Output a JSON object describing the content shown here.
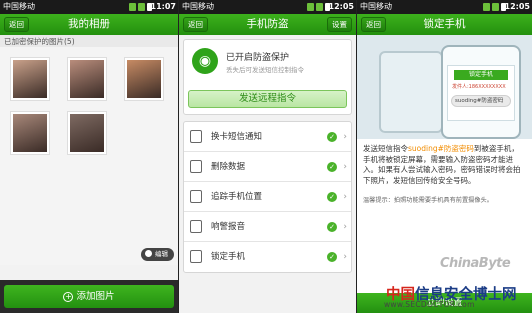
{
  "colors": {
    "accent": "#2a9a14",
    "accent_light": "#b9e6a3",
    "highlight": "#f28c00",
    "status_bar": "#1a1a1a"
  },
  "panel1": {
    "status": {
      "carrier": "中国移动",
      "time": "11:07"
    },
    "header": {
      "back": "返回",
      "title": "我的相册"
    },
    "section_label": "已加密保护的图片(5)",
    "photos": [
      {
        "name": "photo-1",
        "color": "#c9a18a"
      },
      {
        "name": "photo-2",
        "color": "#b98d7c"
      },
      {
        "name": "photo-3",
        "color": "#c78b64"
      },
      {
        "name": "photo-4",
        "color": "#a8887a"
      },
      {
        "name": "photo-5",
        "color": "#7e6a62"
      }
    ],
    "edit_button": "编辑",
    "add_button": "添加图片"
  },
  "panel2": {
    "status": {
      "carrier": "中国移动",
      "time": "12:05"
    },
    "header": {
      "back": "返回",
      "title": "手机防盗",
      "settings": "设置"
    },
    "protect_title": "已开启防盗保护",
    "protect_sub": "丢失后可发送短信控制指令",
    "remote_button": "发送远程指令",
    "menu": [
      {
        "label": "换卡短信通知",
        "icon": "envelope-icon"
      },
      {
        "label": "删除数据",
        "icon": "trash-icon"
      },
      {
        "label": "追踪手机位置",
        "icon": "location-icon"
      },
      {
        "label": "响警报音",
        "icon": "speaker-icon"
      },
      {
        "label": "锁定手机",
        "icon": "lock-icon"
      }
    ]
  },
  "panel3": {
    "status": {
      "carrier": "中国移动",
      "time": "12:05"
    },
    "header": {
      "back": "返回",
      "title": "锁定手机"
    },
    "illus": {
      "lock_title": "锁定手机",
      "sender": "发件人:186XXXXXXXX",
      "bubble": "suoding#防盗密码"
    },
    "desc_before": "发送短信指令",
    "desc_highlight": "suoding#防盗密码",
    "desc_after": "到被盗手机，手机将被锁定屏幕，需要输入防盗密码才能进入。如果有人尝试输入密码，密码错误时将会拍下照片，发短信回传给安全号码。",
    "tip": "温馨提示：拍照功能需要手机具有前置摄像头。",
    "bottom_button": "立即设置"
  },
  "watermark": {
    "logo": "ChinaByte",
    "cn": [
      "中",
      "国",
      "信",
      "息",
      "安",
      "全",
      "博",
      "士",
      "网"
    ],
    "url": "www.SECDOCTOR.com"
  }
}
